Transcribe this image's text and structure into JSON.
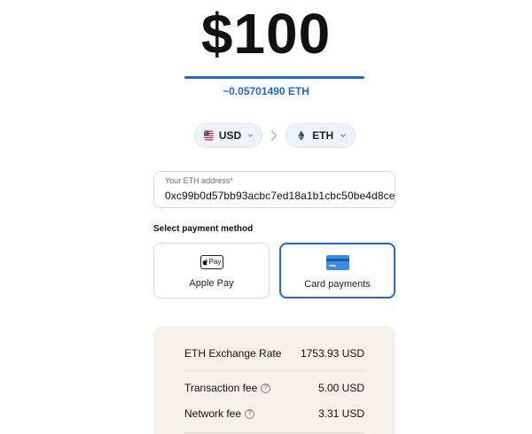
{
  "amount": {
    "value": "$100",
    "crypto_equivalent": "~0.05701490 ETH",
    "accent_color": "#1f66d6"
  },
  "currencies": {
    "fiat": {
      "code": "USD",
      "icon": "us-flag-icon"
    },
    "crypto": {
      "code": "ETH",
      "icon": "ethereum-icon"
    }
  },
  "address": {
    "label": "Your ETH address*",
    "value": "0xc99b0d57bb93acbc7ed18a1b1cbc50be4d8ce"
  },
  "payment": {
    "section_title": "Select payment method",
    "options": [
      {
        "label": "Apple Pay",
        "icon": "apple-pay-icon",
        "badge_text": "Pay",
        "selected": false
      },
      {
        "label": "Card payments",
        "icon": "credit-card-icon",
        "selected": true
      }
    ]
  },
  "summary": {
    "rows": [
      {
        "label": "ETH Exchange Rate",
        "value": "1753.93 USD",
        "help": false
      },
      {
        "label": "Transaction fee",
        "value": "5.00 USD",
        "help": true
      },
      {
        "label": "Network fee",
        "value": "3.31 USD",
        "help": true
      }
    ],
    "help_glyph": "?"
  }
}
